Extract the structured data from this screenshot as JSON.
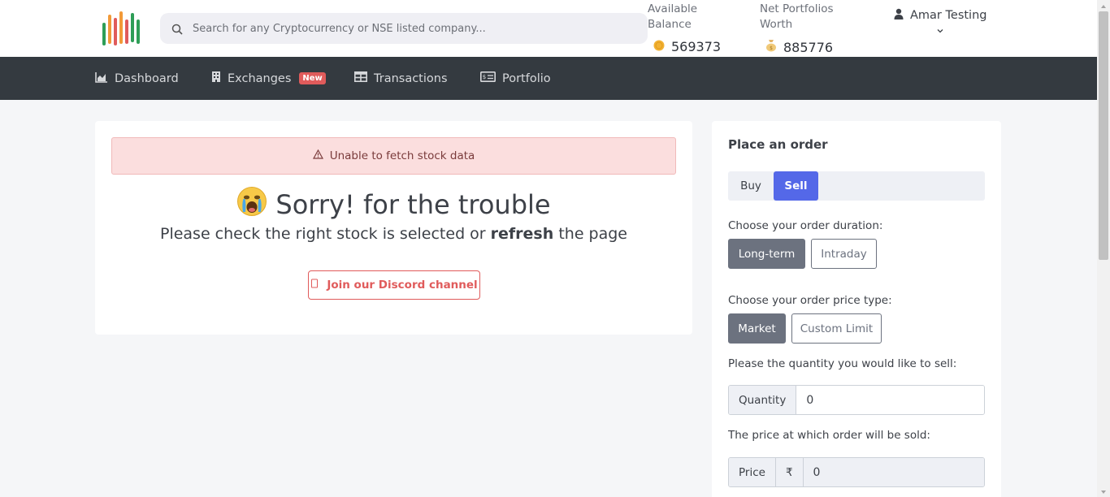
{
  "brand": {
    "logo_icon": "bar-chart-logo-icon",
    "colors": {
      "green": "#2e9e57",
      "orange": "#f29a38",
      "red": "#e05b5b"
    }
  },
  "search": {
    "placeholder": "Search for any Cryptocurrency or NSE listed company...",
    "icon": "search-icon"
  },
  "stats": {
    "available_balance_label": "Available Balance",
    "available_balance_value": "569373",
    "available_balance_icon": "coin-icon",
    "net_worth_label": "Net Portfolios Worth",
    "net_worth_value": "885776",
    "net_worth_icon": "money-bag-icon"
  },
  "user": {
    "name": "Amar Testing",
    "icon": "user-icon"
  },
  "nav": {
    "dashboard": "Dashboard",
    "exchanges": "Exchanges",
    "exchanges_badge": "New",
    "transactions": "Transactions",
    "portfolio": "Portfolio"
  },
  "main": {
    "alert_text": "Unable to fetch stock data",
    "sorry_emoji": "😭",
    "sorry_text": "Sorry! for the trouble",
    "sub_pre": "Please check the right stock is selected or ",
    "sub_bold": "refresh",
    "sub_post": " the page",
    "discord_label": "Join our Discord channel"
  },
  "order": {
    "title": "Place an order",
    "buy_label": "Buy",
    "sell_label": "Sell",
    "selected_side": "Sell",
    "duration_label": "Choose your order duration:",
    "duration_long": "Long-term",
    "duration_intraday": "Intraday",
    "price_type_label": "Choose your order price type:",
    "price_market": "Market",
    "price_custom": "Custom Limit",
    "quantity_prompt": "Please the quantity you would like to sell:",
    "quantity_addon": "Quantity",
    "quantity_value": "0",
    "price_prompt": "The price at which order will be sold:",
    "price_addon": "Price",
    "currency_symbol": "₹",
    "price_value": "0",
    "accent_color": "#5468e8"
  }
}
